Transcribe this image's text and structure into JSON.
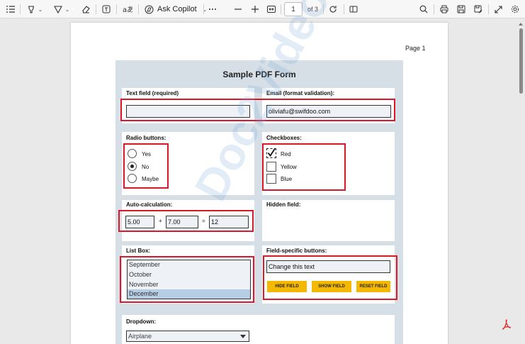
{
  "toolbar": {
    "ask_copilot": "Ask Copilot",
    "page_current": "1",
    "page_of": "of 3"
  },
  "document": {
    "page_label": "Page 1",
    "form_title": "Sample PDF Form",
    "watermark": "Doc2Video",
    "sections": {
      "text_field_label": "Text field (required)",
      "text_field_value": "",
      "email_label": "Email (format validation):",
      "email_value": "oliviafu@swifdoo.com",
      "radio_label": "Radio buttons:",
      "radio_options": [
        "Yes",
        "No",
        "Maybe"
      ],
      "radio_selected": "No",
      "checkbox_label": "Checkboxes:",
      "checkbox_options": [
        "Red",
        "Yellow",
        "Blue"
      ],
      "checkbox_checked": [
        "Red"
      ],
      "autocalc_label": "Auto-calculation:",
      "autocalc_a": "5.00",
      "autocalc_plus": "+",
      "autocalc_b": "7.00",
      "autocalc_equals": "=",
      "autocalc_result": "12",
      "hidden_label": "Hidden field:",
      "listbox_label": "List Box:",
      "listbox_items": [
        "September",
        "October",
        "November",
        "December"
      ],
      "listbox_selected": "December",
      "buttons_label": "Field-specific buttons:",
      "buttons_text_value": "Change this text",
      "hide_button": "HIDE FIELD",
      "show_button": "SHOW FIELD",
      "reset_button": "RESET FIELD",
      "dropdown_label": "Dropdown:",
      "dropdown_value": "Airplane"
    }
  },
  "colors": {
    "highlight_red": "#d9182a",
    "form_bg": "#d6dee6",
    "button_yellow": "#f5b800",
    "list_selection": "#b6cde3"
  },
  "icons": [
    "menu-icon",
    "highlight-icon",
    "draw-icon",
    "eraser-icon",
    "text-box-icon",
    "read-aloud-icon",
    "copilot-icon",
    "more-icon",
    "zoom-out-icon",
    "zoom-in-icon",
    "fit-page-icon",
    "rotate-icon",
    "page-view-icon",
    "search-icon",
    "print-icon",
    "save-icon",
    "save-as-icon",
    "fullscreen-icon",
    "settings-icon",
    "acrobat-icon"
  ]
}
